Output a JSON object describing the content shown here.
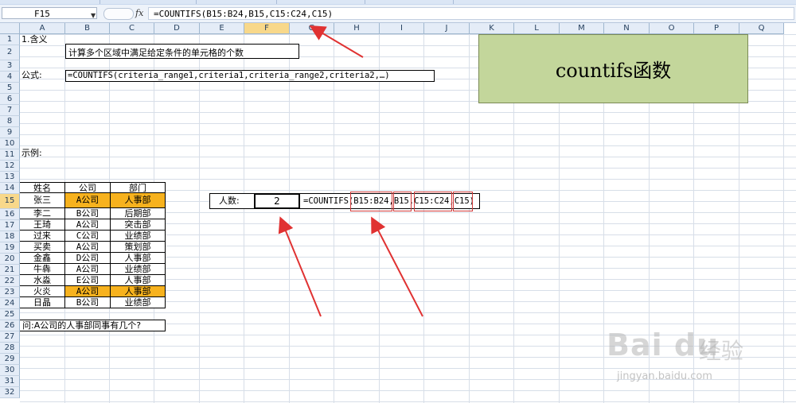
{
  "formula_bar": {
    "name_box": "F15",
    "fx_label": "fx",
    "formula": "=COUNTIFS(B15:B24,B15,C15:C24,C15)"
  },
  "columns": [
    "A",
    "B",
    "C",
    "D",
    "E",
    "F",
    "G",
    "H",
    "I",
    "J",
    "K",
    "L",
    "M",
    "N",
    "O",
    "P",
    "Q"
  ],
  "selected_column": "F",
  "rows": [
    "1",
    "2",
    "3",
    "4",
    "5",
    "6",
    "7",
    "8",
    "9",
    "10",
    "11",
    "12",
    "13",
    "14",
    "15",
    "16",
    "17",
    "18",
    "19",
    "20",
    "21",
    "22",
    "23",
    "24",
    "25",
    "26",
    "27",
    "28",
    "29",
    "30",
    "31",
    "32"
  ],
  "selected_row": "15",
  "content": {
    "heading": "1.含义",
    "meaning": "计算多个区域中满足给定条件的单元格的个数",
    "formula_label": "公式:",
    "syntax": "=COUNTIFS(criteria_range1,criteria1,criteria_range2,criteria2,…)",
    "example_label": "示例:",
    "banner": "countifs函数",
    "question": "问:A公司的人事部同事有几个?"
  },
  "table": {
    "headers": [
      "姓名",
      "公司",
      "部门"
    ],
    "rows": [
      [
        "张三",
        "A公司",
        "人事部"
      ],
      [
        "李二",
        "B公司",
        "后期部"
      ],
      [
        "王琦",
        "A公司",
        "突击部"
      ],
      [
        "过来",
        "C公司",
        "业绩部"
      ],
      [
        "买卖",
        "A公司",
        "策划部"
      ],
      [
        "金鑫",
        "D公司",
        "人事部"
      ],
      [
        "牛犇",
        "A公司",
        "业绩部"
      ],
      [
        "水淼",
        "E公司",
        "人事部"
      ],
      [
        "火炎",
        "A公司",
        "人事部"
      ],
      [
        "日晶",
        "B公司",
        "业绩部"
      ]
    ],
    "highlight_rows": [
      0,
      8
    ],
    "highlight_color": "#f7b21e"
  },
  "result": {
    "label": "人数:",
    "value": "2",
    "formula_parts": [
      "=COUNTIFS(",
      "B15:B24",
      ",",
      "B15",
      ",",
      "C15:C24",
      ",",
      "C15",
      ")"
    ]
  },
  "watermark": {
    "logo": "Bai du",
    "text": "经验",
    "url": "jingyan.baidu.com"
  },
  "colors": {
    "banner": "#c3d69b",
    "arrow": "#e03232",
    "header_bg": "#e4ecf7",
    "selected_header": "#f8d88a"
  }
}
